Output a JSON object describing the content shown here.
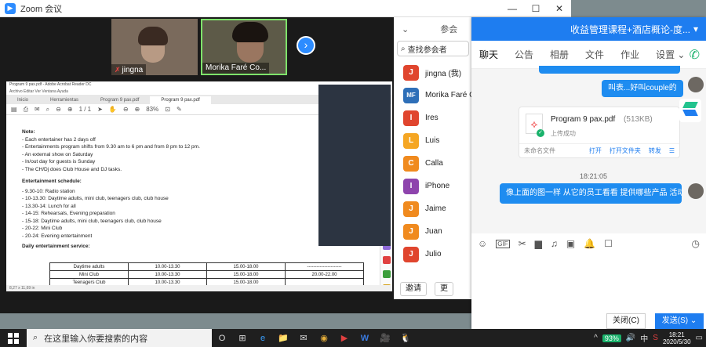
{
  "zoom": {
    "title": "Zoom 会议",
    "window_controls": {
      "minimize": "—",
      "maximize": "☐",
      "close": "✕"
    },
    "videos": [
      {
        "name": "jingna"
      },
      {
        "name": "Morika Faré Co..."
      }
    ],
    "next_arrow": "›"
  },
  "pdf": {
    "title": "Program 9 pax.pdf - Adobe Acrobat Reader DC",
    "menu": "Archivo  Editar  Ver  Ventana  Ayuda",
    "tabs": [
      "Inicio",
      "Herramientas",
      "Program 9 pax.pdf",
      "Program 9 pax.pdf"
    ],
    "page_indicator": "1 / 1",
    "zoom": "83%",
    "statusbar": "8,27 x 11,69 in",
    "note_title": "Note:",
    "notes": [
      "-     Each entertainer has 2 days off",
      "-     Entertainments program shifts from 9.30 am to 6 pm and from 8 pm to 12 pm.",
      "-     An external show on Saturday",
      "-     In/out day for guests is Sunday",
      "-     The CH/Dj does Club House and DJ tasks."
    ],
    "schedule_title": "Entertainment schedule:",
    "schedule": [
      "-     9.30-10: Radio station",
      "-     10-13.30: Daytime adults, mini club, teenagers club, club house",
      "-     13.30-14: Lunch for all",
      "-     14-15: Rehearsals, Evening preparation",
      "-     15-18: Daytime adults, mini club, teenagers club, club house",
      "-     20-22: Mini Club",
      "-     20-24: Evening entertainment"
    ],
    "daily_title": "Daily entertainment service:",
    "table": [
      [
        "Daytime adults",
        "10.00-13.30",
        "15.00-18.00",
        "----------------------"
      ],
      [
        "Mini Club",
        "10.00-13.30",
        "15.00-18.00",
        "20.00-22.00"
      ],
      [
        "Teenagers Club",
        "10.00-13.30",
        "15.00-18.00",
        ""
      ]
    ]
  },
  "participants": {
    "header": "参会",
    "collapse_icon": "⌄",
    "search_placeholder": "查找参会者",
    "list": [
      {
        "initial": "J",
        "name": "jingna (我)",
        "color": "#e0452e"
      },
      {
        "initial": "MF",
        "name": "Morika Faré C",
        "color": "#2e6fb8"
      },
      {
        "initial": "I",
        "name": "Ires",
        "color": "#e0452e"
      },
      {
        "initial": "L",
        "name": "Luis",
        "color": "#f5a623"
      },
      {
        "initial": "C",
        "name": "Calla",
        "color": "#f08a1e"
      },
      {
        "initial": "I",
        "name": "iPhone",
        "color": "#8e44ad"
      },
      {
        "initial": "J",
        "name": "Jaime",
        "color": "#f08a1e"
      },
      {
        "initial": "J",
        "name": "Juan",
        "color": "#f08a1e"
      },
      {
        "initial": "J",
        "name": "Julio",
        "color": "#e0452e"
      }
    ],
    "footer": {
      "invite": "邀请",
      "more": "更"
    }
  },
  "chat": {
    "title": "收益管理课程+酒店概论-度...",
    "menu_icon": "▾",
    "tabs": [
      "聊天",
      "公告",
      "相册",
      "文件",
      "作业",
      "设置 ⌄"
    ],
    "call_icon": "✆",
    "messages": [
      {
        "text": ""
      },
      {
        "text": "叫表...好叫couple的"
      },
      {
        "text": "像上面的图一样 从它的员工看看 提供哪些产品 活动"
      }
    ],
    "file": {
      "name": "Program 9 pax.pdf",
      "size": "(513KB)",
      "status": "上传成功",
      "uploader": "未命名文件",
      "actions": [
        "打开",
        "打开文件夹",
        "转发"
      ],
      "menu": "☰"
    },
    "timestamp": "18:21:05",
    "toolbar_icons": [
      "☺",
      "GIF",
      "✂",
      "▆",
      "♫",
      "▣",
      "🔔",
      "☐"
    ],
    "history_icon": "◷",
    "close_label": "关闭(C)",
    "send_label": "发送(S) ⌄"
  },
  "taskbar": {
    "search_placeholder": "在这里输入你要搜索的内容",
    "icons": [
      "O",
      "⊞",
      "e",
      "📁",
      "✉",
      "◉",
      "▶",
      "W",
      "🎥",
      "🐧"
    ],
    "battery": "93%",
    "tray_icons": [
      "^",
      "🔊",
      "中",
      "S"
    ],
    "time": "18:21",
    "date": "2020/5/30",
    "notify_icon": "▭"
  },
  "colors": {
    "accent": "#1e7df0",
    "zoom_blue": "#2d8cff",
    "taskbar": "#1f1f1f"
  }
}
